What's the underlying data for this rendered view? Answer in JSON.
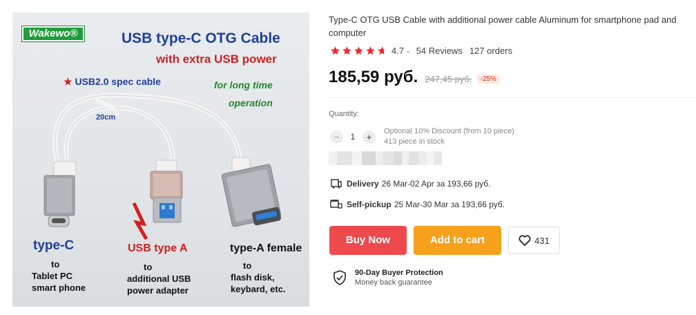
{
  "image": {
    "brand": "Wakewo®",
    "title": "USB type-C OTG Cable",
    "subtitle": "with extra USB power",
    "spec": "USB2.0 spec cable",
    "long_time_1": "for long time",
    "long_time_2": "operation",
    "length": "20cm",
    "typec_label": "type-C",
    "typec_to": "to",
    "typec_target_1": "Tablet PC",
    "typec_target_2": "smart phone",
    "usba_label": "USB type A",
    "usba_to": "to",
    "usba_target_1": "additional USB",
    "usba_target_2": "power adapter",
    "female_label": "type-A female",
    "female_to": "to",
    "female_target_1": "flash disk,",
    "female_target_2": "keybard, etc."
  },
  "product": {
    "title": "Type-C OTG USB Cable with additional power cable Aluminum for smartphone pad and computer",
    "rating": "4.7",
    "rating_value": 4.7,
    "reviews": "54 Reviews",
    "orders": "127 orders",
    "price": "185,59 руб.",
    "old_price": "247,45 руб.",
    "discount": "-25%"
  },
  "quantity": {
    "label": "Quantity:",
    "minus": "−",
    "value": "1",
    "plus": "+",
    "discount_note": "Optional 10% Discount (from 10 piece)",
    "stock": "413 piece in stock"
  },
  "shipping": {
    "delivery_label": "Delivery",
    "delivery_text": "26 Mar-02 Apr за 193,66 руб.",
    "pickup_label": "Self-pickup",
    "pickup_text": "25 Mar-30 Mar за 193,66 руб."
  },
  "actions": {
    "buy_now": "Buy Now",
    "add_to_cart": "Add to cart",
    "wishlist_count": "431"
  },
  "protection": {
    "title": "90-Day Buyer Protection",
    "subtitle": "Money back guarantee"
  },
  "colors": {
    "buy_now": "#ee4a4e",
    "add_to_cart": "#f6a01c",
    "star": "#f0272d",
    "discount": "#e62e04"
  }
}
